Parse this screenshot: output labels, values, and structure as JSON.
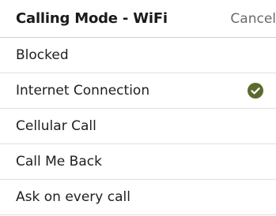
{
  "header": {
    "title": "Calling Mode - WiFi",
    "cancel_label": "Cancel"
  },
  "options": [
    {
      "label": "Blocked",
      "selected": false
    },
    {
      "label": "Internet Connection",
      "selected": true
    },
    {
      "label": "Cellular Call",
      "selected": false
    },
    {
      "label": "Call Me Back",
      "selected": false
    },
    {
      "label": "Ask on every call",
      "selected": false
    }
  ],
  "colors": {
    "check_fill": "#5a6b2f",
    "divider": "#e0e0e0",
    "cancel_text": "#6a6a6a"
  },
  "icons": {
    "selected_marker": "check-circle-icon"
  }
}
